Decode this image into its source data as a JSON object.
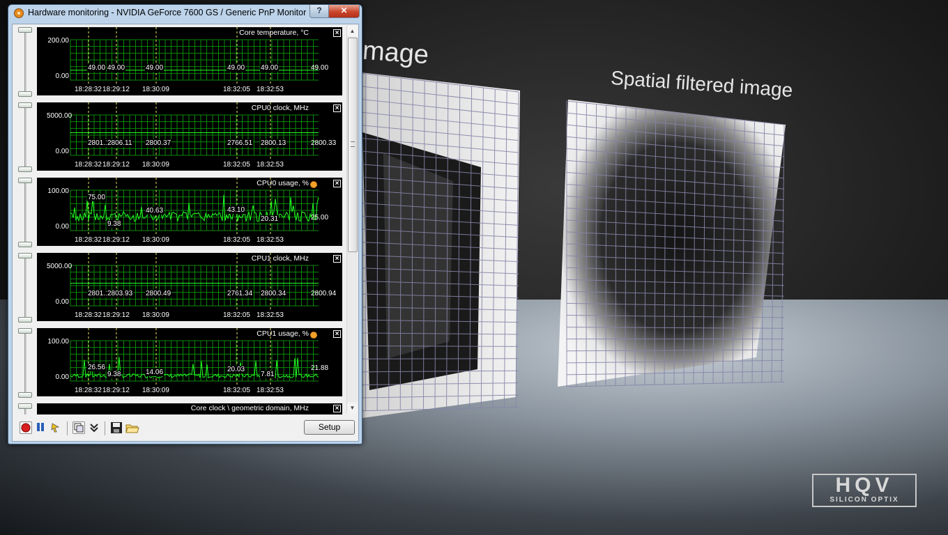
{
  "window": {
    "title": "Hardware monitoring - NVIDIA GeForce 7600 GS  / Generic PnP Monitor",
    "help_label": "?",
    "close_label": "✕"
  },
  "graphs": [
    {
      "title": "Core temperature, °C",
      "y_max": "200.00",
      "y_min": "0.00",
      "current": "49.00",
      "times": [
        "18:28:32",
        "18:29:12",
        "18:30:09",
        "18:32:05",
        "18:32:53"
      ],
      "values": [
        "49.00",
        "49.00",
        "49.00",
        "49.00",
        "49.00"
      ],
      "has_gear": false
    },
    {
      "title": "CPU0 clock, MHz",
      "y_max": "5000.00",
      "y_min": "0.00",
      "current": "2800.33",
      "times": [
        "18:28:32",
        "18:29:12",
        "18:30:09",
        "18:32:05",
        "18:32:53"
      ],
      "values": [
        "2801.16",
        "2806.11",
        "2800.37",
        "2766.51",
        "2800.13"
      ],
      "has_gear": false
    },
    {
      "title": "CPU0 usage, %",
      "y_max": "100.00",
      "y_min": "0.00",
      "current": "25.00",
      "times": [
        "18:28:32",
        "18:29:12",
        "18:30:09",
        "18:32:05",
        "18:32:53"
      ],
      "values": [
        "75.00",
        "9.38",
        "40.63",
        "43.10",
        "20.31"
      ],
      "has_gear": true
    },
    {
      "title": "CPU1 clock, MHz",
      "y_max": "5000.00",
      "y_min": "0.00",
      "current": "2800.94",
      "times": [
        "18:28:32",
        "18:29:12",
        "18:30:09",
        "18:32:05",
        "18:32:53"
      ],
      "values": [
        "2801.19",
        "2803.93",
        "2800.49",
        "2761.34",
        "2800.34"
      ],
      "has_gear": false
    },
    {
      "title": "CPU1 usage, %",
      "y_max": "100.00",
      "y_min": "0.00",
      "current": "21.88",
      "times": [
        "18:28:32",
        "18:29:12",
        "18:30:09",
        "18:32:05",
        "18:32:53"
      ],
      "values": [
        "26.56",
        "9.38",
        "14.06",
        "20.03",
        "7.81"
      ],
      "has_gear": true
    }
  ],
  "partial_graph": {
    "title": "Core clock \\ geometric domain, MHz"
  },
  "toolbar": {
    "setup_label": "Setup",
    "icons": [
      "record-icon",
      "pause-icon",
      "marker-icon",
      "copy-icon",
      "collapse-icon",
      "save-icon",
      "open-folder-icon"
    ]
  },
  "background": {
    "title_left": "mage",
    "title_right": "Spatial filtered image",
    "logo_main": "HQV",
    "logo_sub": "SILICON OPTIX"
  },
  "colors": {
    "graph_line": "#22ff22",
    "graph_grid": "#0b8a0b",
    "graph_bg": "#000000",
    "marker": "#e8e86a",
    "window_frame": "#bcd3ea"
  }
}
